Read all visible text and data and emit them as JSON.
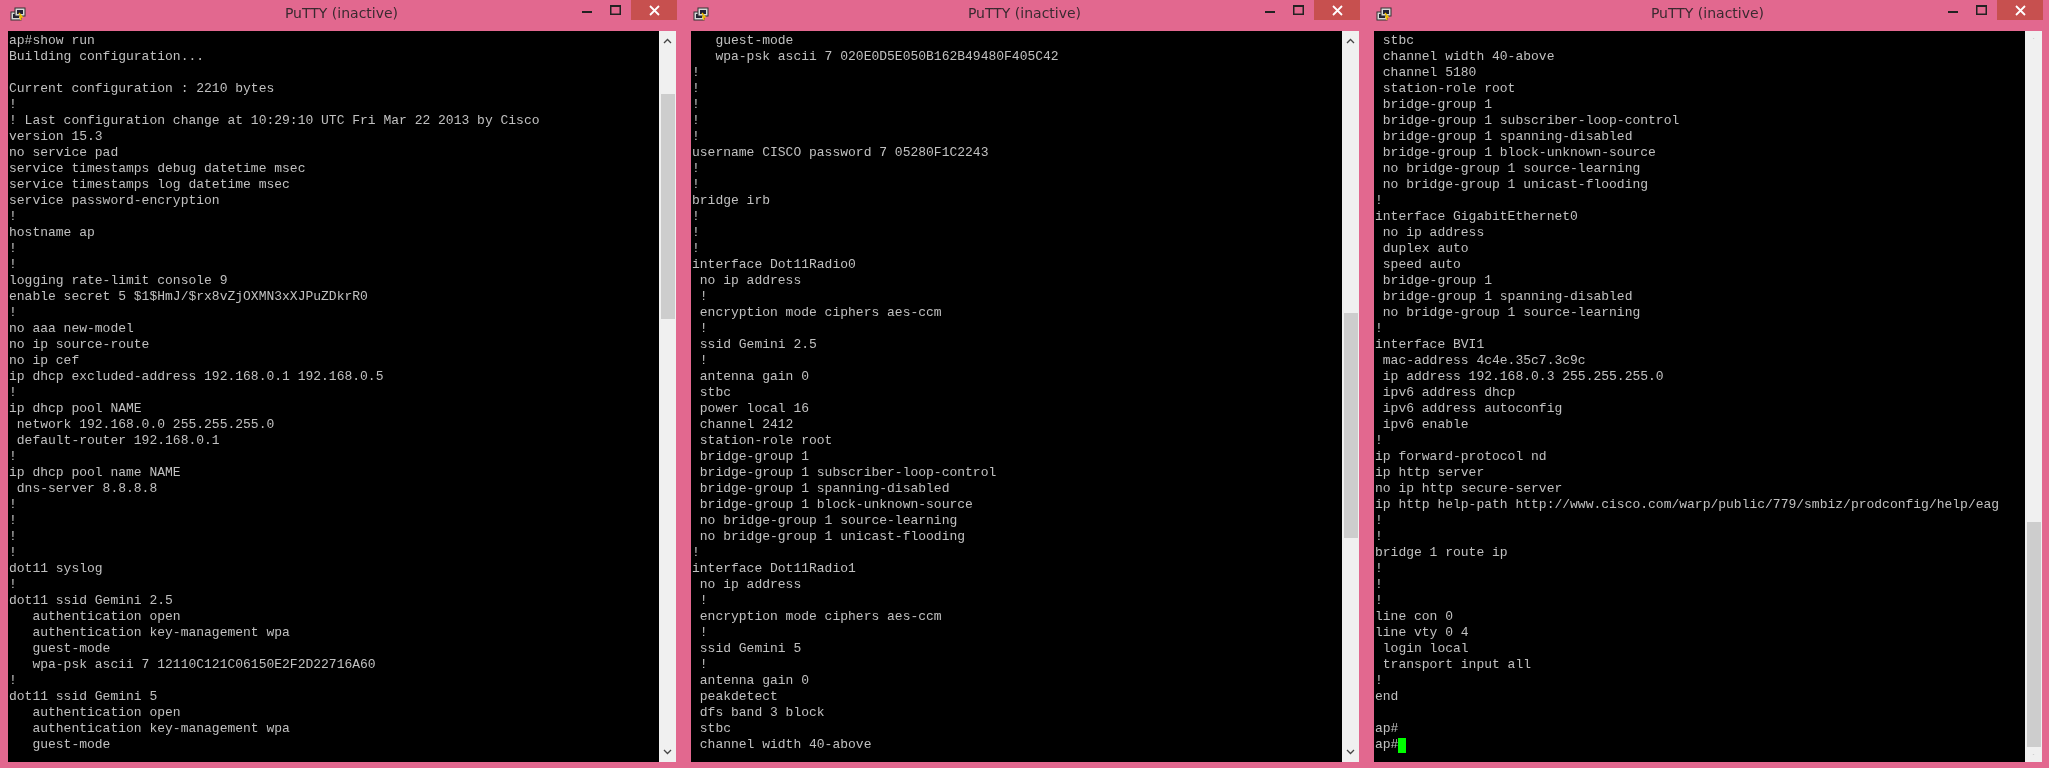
{
  "windows": [
    {
      "title": "PuTTY (inactive)",
      "cursor": false,
      "lines": [
        "ap#show run",
        "Building configuration...",
        {
          "kind": "blank"
        },
        "Current configuration : 2210 bytes",
        "!",
        "! Last configuration change at 10:29:10 UTC Fri Mar 22 2013 by Cisco",
        "version 15.3",
        "no service pad",
        "service timestamps debug datetime msec",
        "service timestamps log datetime msec",
        "service password-encryption",
        "!",
        "hostname ap",
        "!",
        "!",
        "logging rate-limit console 9",
        "enable secret 5 $1$HmJ/$rx8vZjOXMN3xXJPuZDkrR0",
        "!",
        "no aaa new-model",
        "no ip source-route",
        "no ip cef",
        "ip dhcp excluded-address 192.168.0.1 192.168.0.5",
        "!",
        "ip dhcp pool NAME",
        " network 192.168.0.0 255.255.255.0",
        " default-router 192.168.0.1",
        "!",
        "ip dhcp pool name NAME",
        " dns-server 8.8.8.8",
        "!",
        "!",
        "!",
        "!",
        "dot11 syslog",
        "!",
        "dot11 ssid Gemini 2.5",
        "   authentication open",
        "   authentication key-management wpa",
        "   guest-mode",
        "   wpa-psk ascii 7 12110C121C06150E2F2D22716A60",
        "!",
        "dot11 ssid Gemini 5",
        "   authentication open",
        "   authentication key-management wpa",
        "   guest-mode"
      ]
    },
    {
      "title": "PuTTY (inactive)",
      "cursor": false,
      "lines": [
        "   guest-mode",
        "   wpa-psk ascii 7 020E0D5E050B162B49480F405C42",
        "!",
        "!",
        "!",
        "!",
        "!",
        "username CISCO password 7 05280F1C2243",
        "!",
        "!",
        "bridge irb",
        "!",
        "!",
        "!",
        "interface Dot11Radio0",
        " no ip address",
        " !",
        " encryption mode ciphers aes-ccm",
        " !",
        " ssid Gemini 2.5",
        " !",
        " antenna gain 0",
        " stbc",
        " power local 16",
        " channel 2412",
        " station-role root",
        " bridge-group 1",
        " bridge-group 1 subscriber-loop-control",
        " bridge-group 1 spanning-disabled",
        " bridge-group 1 block-unknown-source",
        " no bridge-group 1 source-learning",
        " no bridge-group 1 unicast-flooding",
        "!",
        "interface Dot11Radio1",
        " no ip address",
        " !",
        " encryption mode ciphers aes-ccm",
        " !",
        " ssid Gemini 5",
        " !",
        " antenna gain 0",
        " peakdetect",
        " dfs band 3 block",
        " stbc",
        " channel width 40-above"
      ]
    },
    {
      "title": "PuTTY (inactive)",
      "cursor": true,
      "lines": [
        " stbc",
        " channel width 40-above",
        " channel 5180",
        " station-role root",
        " bridge-group 1",
        " bridge-group 1 subscriber-loop-control",
        " bridge-group 1 spanning-disabled",
        " bridge-group 1 block-unknown-source",
        " no bridge-group 1 source-learning",
        " no bridge-group 1 unicast-flooding",
        "!",
        "interface GigabitEthernet0",
        " no ip address",
        " duplex auto",
        " speed auto",
        " bridge-group 1",
        " bridge-group 1 spanning-disabled",
        " no bridge-group 1 source-learning",
        "!",
        "interface BVI1",
        " mac-address 4c4e.35c7.3c9c",
        " ip address 192.168.0.3 255.255.255.0",
        " ipv6 address dhcp",
        " ipv6 address autoconfig",
        " ipv6 enable",
        "!",
        "ip forward-protocol nd",
        "ip http server",
        "no ip http secure-server",
        "ip http help-path http://www.cisco.com/warp/public/779/smbiz/prodconfig/help/eag",
        "!",
        "!",
        "bridge 1 route ip",
        "!",
        "!",
        "!",
        "line con 0",
        "line vty 0 4",
        " login local",
        " transport input all",
        "!",
        "end",
        {
          "kind": "blank"
        },
        "ap#",
        "ap#"
      ]
    }
  ]
}
